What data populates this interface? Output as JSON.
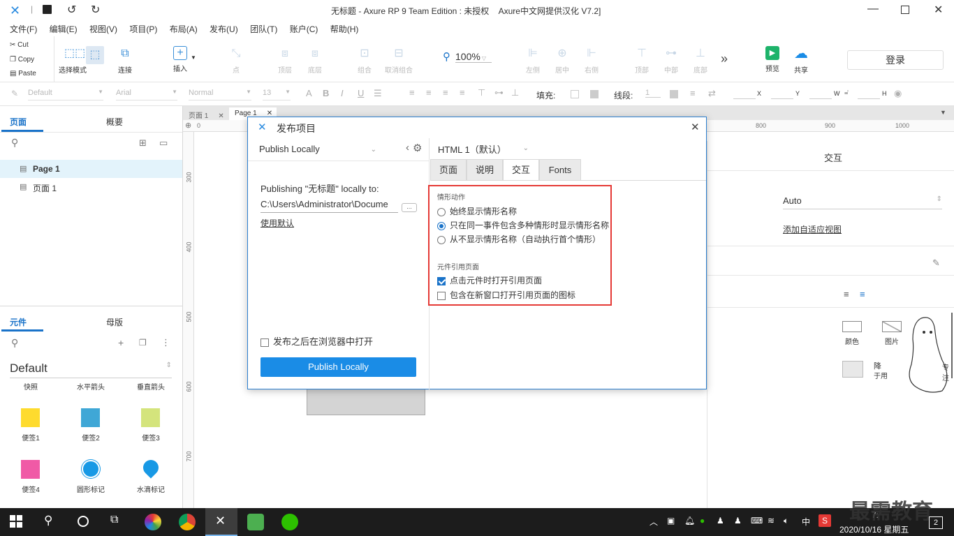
{
  "window": {
    "title": "无标题 - Axure RP 9 Team Edition : 未授权    Axure中文网提供汉化 V7.2]"
  },
  "menu": [
    "文件(F)",
    "编辑(E)",
    "视图(V)",
    "项目(P)",
    "布局(A)",
    "发布(U)",
    "团队(T)",
    "账户(C)",
    "帮助(H)"
  ],
  "clipboard": {
    "cut": "Cut",
    "copy": "Copy",
    "paste": "Paste"
  },
  "toolbar": {
    "select_mode": "选择模式",
    "connect": "连接",
    "insert": "插入",
    "point": "点",
    "top_layer": "顶层",
    "bottom_layer": "底层",
    "group": "组合",
    "ungroup": "取消组合",
    "zoom": "100%",
    "align_left": "左侧",
    "align_center": "居中",
    "align_right": "右侧",
    "align_top": "顶部",
    "align_middle": "中部",
    "align_bottom": "底部",
    "more": "»",
    "preview": "预览",
    "share": "共享",
    "login": "登录"
  },
  "format": {
    "style": "Default",
    "font": "Arial",
    "weight": "Normal",
    "size": "13",
    "fill_label": "填充:",
    "line_label": "线段:",
    "line_value": "1",
    "x": "X",
    "y": "Y",
    "w": "W",
    "h": "H"
  },
  "left_panel": {
    "tab_pages": "页面",
    "tab_outline": "概要",
    "pages": [
      {
        "name": "Page 1",
        "selected": true
      },
      {
        "name": "页面 1",
        "selected": false
      }
    ],
    "tab_widgets": "元件",
    "tab_masters": "母版",
    "library": "Default",
    "widget_headers": [
      "快照",
      "水平箭头",
      "垂直箭头"
    ],
    "widgets": [
      {
        "name": "便签1",
        "color": "#fedb2e"
      },
      {
        "name": "便签2",
        "color": "#3fa7d6"
      },
      {
        "name": "便签3",
        "color": "#d4e47c"
      },
      {
        "name": "便签4",
        "color": "#f05aa6"
      },
      {
        "name": "圆形标记",
        "color": "#1899e5"
      },
      {
        "name": "水滴标记",
        "color": "#1899e5"
      }
    ]
  },
  "canvas": {
    "tabs": [
      "页面 1",
      "Page 1"
    ],
    "ruler_top": [
      "0",
      "800",
      "900",
      "1000"
    ],
    "ruler_left": [
      "300",
      "400",
      "500",
      "600",
      "700"
    ]
  },
  "right_panel": {
    "interaction": "交互",
    "adaptive": "Auto",
    "add_view": "添加自适应视图",
    "items": [
      "颜色",
      "图片"
    ],
    "partial_text": [
      "降",
      "于用",
      "专注"
    ]
  },
  "dialog": {
    "title": "发布项目",
    "target": "Publish Locally",
    "publishing_label": "Publishing \"无标题\" locally to:",
    "path": "C:\\Users\\Administrator\\Docume",
    "browse": "…",
    "use_default": "使用默认",
    "open_after": "发布之后在浏览器中打开",
    "publish_button": "Publish Locally",
    "format": "HTML 1（默认）",
    "tabs": [
      "页面",
      "说明",
      "交互",
      "Fonts"
    ],
    "active_tab": "交互",
    "section1_title": "情形动作",
    "radios": [
      {
        "label": "始终显示情形名称",
        "checked": false
      },
      {
        "label": "只在同一事件包含多种情形时显示情形名称",
        "checked": true
      },
      {
        "label": "从不显示情形名称（自动执行首个情形）",
        "checked": false
      }
    ],
    "section2_title": "元件引用页面",
    "checks": [
      {
        "label": "点击元件时打开引用页面",
        "checked": true
      },
      {
        "label": "包含在新窗口打开引用页面的图标",
        "checked": false
      }
    ],
    "highlight_color": "#e53935"
  },
  "taskbar": {
    "time": "7:",
    "date": "2020/10/16 星期五",
    "ime": "中",
    "notif_count": "2",
    "watermark": "最需教育"
  },
  "colors": {
    "accent": "#1a73c9",
    "button": "#1a8ce6"
  }
}
